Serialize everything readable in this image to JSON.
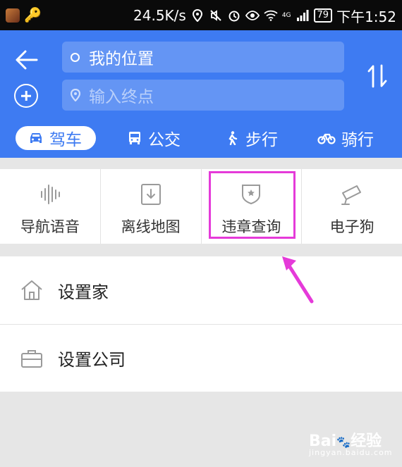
{
  "status_bar": {
    "speed": "24.5K/s",
    "network": "4G",
    "battery": "79",
    "time": "下午1:52"
  },
  "route_panel": {
    "start_value": "我的位置",
    "end_placeholder": "输入终点"
  },
  "travel_modes": [
    {
      "label": "驾车",
      "icon": "car-icon"
    },
    {
      "label": "公交",
      "icon": "bus-icon"
    },
    {
      "label": "步行",
      "icon": "walk-icon"
    },
    {
      "label": "骑行",
      "icon": "bike-icon"
    }
  ],
  "tools": [
    {
      "label": "导航语音",
      "icon": "voice-wave-icon"
    },
    {
      "label": "离线地图",
      "icon": "download-icon"
    },
    {
      "label": "违章查询",
      "icon": "shield-star-icon"
    },
    {
      "label": "电子狗",
      "icon": "camera-icon"
    }
  ],
  "shortcuts": [
    {
      "label": "设置家",
      "icon": "home-icon"
    },
    {
      "label": "设置公司",
      "icon": "briefcase-icon"
    }
  ],
  "watermark": {
    "text": "Bai",
    "text2": "经验",
    "sub": "jingyan.baidu.com"
  },
  "colors": {
    "brand": "#3e7bf2",
    "highlight": "#e53ad9"
  }
}
